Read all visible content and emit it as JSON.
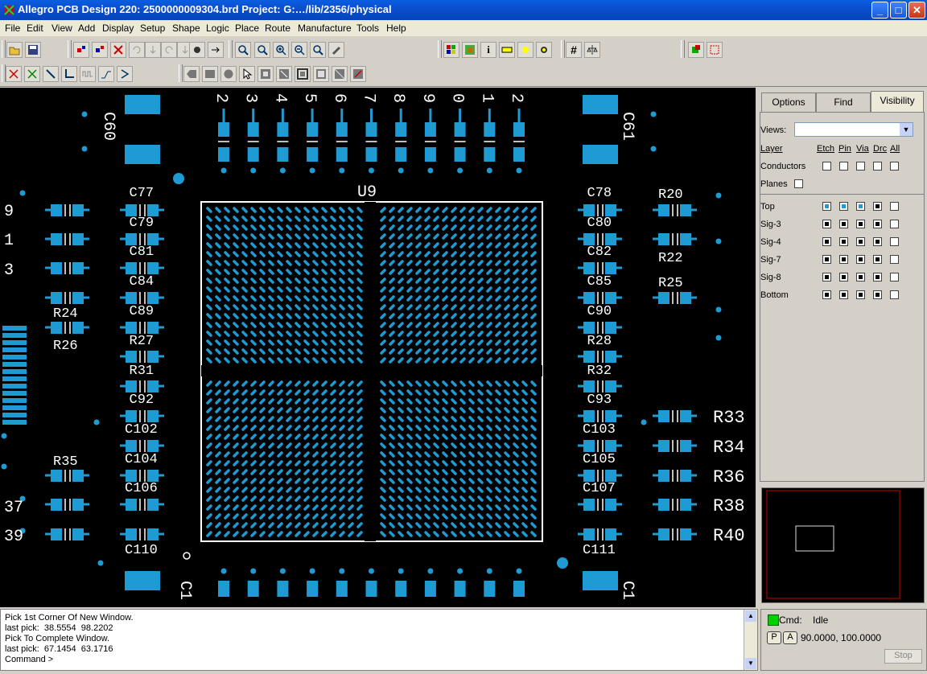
{
  "window": {
    "title": "Allegro PCB Design 220: 2500000009304.brd  Project: G:…/lib/2356/physical",
    "minimize": "_",
    "maximize": "□",
    "close": "✕"
  },
  "menu": [
    "File",
    "Edit",
    "View",
    "Add",
    "Display",
    "Setup",
    "Shape",
    "Logic",
    "Place",
    "Route",
    "Manufacture",
    "Tools",
    "Help"
  ],
  "toolbar": {
    "info_glyph": "i",
    "grid_glyph": "#"
  },
  "board": {
    "chip_label": "U9",
    "top_pin_numbers": [
      "2",
      "3",
      "4",
      "5",
      "6",
      "7",
      "8",
      "9",
      "0",
      "1",
      "2"
    ],
    "left_edge_numbers": [
      "9",
      "1",
      "3"
    ],
    "left_lower_numbers": [
      "37",
      "39"
    ],
    "left_caps": [
      "C77",
      "C79",
      "C81",
      "C84",
      "C89",
      "R27",
      "R31",
      "C92",
      "C102",
      "C104",
      "C106",
      "C110"
    ],
    "right_caps": [
      "C78",
      "C80",
      "C82",
      "C85",
      "C90",
      "R28",
      "R32",
      "C93",
      "C103",
      "C105",
      "C107",
      "C111"
    ],
    "far_left_labels": [
      "R24",
      "R26",
      "R35"
    ],
    "far_right_labels_upper": [
      "R20",
      "R22",
      "R25"
    ],
    "far_right_labels_lower": [
      "R33",
      "R34",
      "R36",
      "R38",
      "R40"
    ],
    "top_corner_caps": [
      "C60",
      "C61"
    ],
    "bottom_partial_labels": [
      "C1",
      "C1"
    ]
  },
  "panel": {
    "tabs": [
      "Options",
      "Find",
      "Visibility"
    ],
    "views_label": "Views:",
    "views_value": "",
    "columns": [
      "Layer",
      "Etch",
      "Pin",
      "Via",
      "Drc",
      "All"
    ],
    "global_rows": [
      "Conductors",
      "Planes"
    ],
    "layers": [
      {
        "name": "Top",
        "etch": "blue",
        "pin": "blue",
        "via": "blue",
        "drc": "black",
        "all": "empty"
      },
      {
        "name": "Sig-3",
        "etch": "black",
        "pin": "black",
        "via": "black",
        "drc": "black",
        "all": "empty"
      },
      {
        "name": "Sig-4",
        "etch": "black",
        "pin": "black",
        "via": "black",
        "drc": "black",
        "all": "empty"
      },
      {
        "name": "Sig-7",
        "etch": "black",
        "pin": "black",
        "via": "black",
        "drc": "black",
        "all": "empty"
      },
      {
        "name": "Sig-8",
        "etch": "black",
        "pin": "black",
        "via": "black",
        "drc": "black",
        "all": "empty"
      },
      {
        "name": "Bottom",
        "etch": "black",
        "pin": "black",
        "via": "black",
        "drc": "black",
        "all": "empty"
      }
    ]
  },
  "console": {
    "lines": [
      "Pick 1st Corner Of New Window.",
      "last pick:  38.5554  98.2202",
      "Pick To Complete Window.",
      "last pick:  67.1454  63.1716",
      "Command >"
    ]
  },
  "status": {
    "cmd_label": "Cmd:",
    "cmd_value": "Idle",
    "p_button": "P",
    "a_button": "A",
    "coords": "90.0000, 100.0000",
    "stop_button": "Stop"
  },
  "colors": {
    "copper": "#1e9bd2",
    "background": "#000000",
    "silkscreen": "#ffffff",
    "title_bar": "#0a5ee0"
  }
}
